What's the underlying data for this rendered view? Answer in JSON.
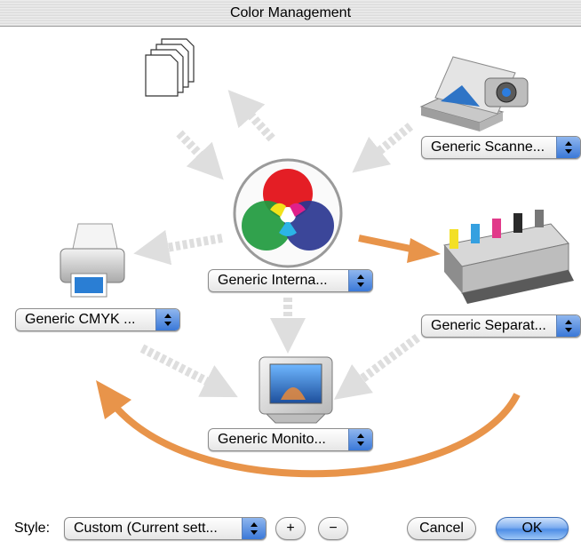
{
  "window": {
    "title": "Color Management"
  },
  "devices": {
    "center_profile": "Generic Interna...",
    "scanner_profile": "Generic Scanne...",
    "printer_profile": "Generic CMYK ...",
    "press_profile": "Generic Separat...",
    "monitor_profile": "Generic Monito..."
  },
  "footer": {
    "style_label": "Style:",
    "style_value": "Custom (Current sett...",
    "add_label": "+",
    "remove_label": "−",
    "cancel_label": "Cancel",
    "ok_label": "OK"
  },
  "colors": {
    "accent_arrow": "#e8944a",
    "flow_arrow": "#dedede",
    "button_blue": "#4f8ee6"
  }
}
